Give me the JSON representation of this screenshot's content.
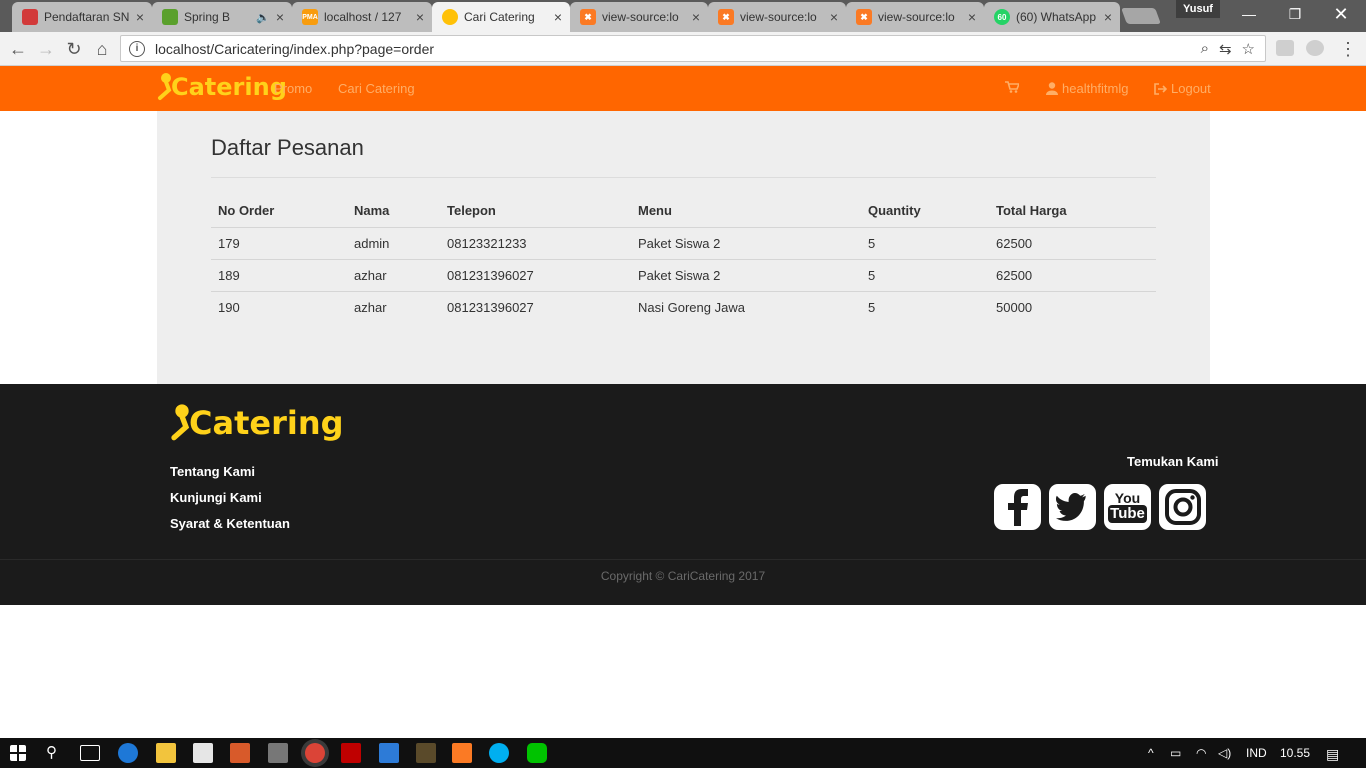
{
  "browser": {
    "tabs": [
      {
        "label": "Pendaftaran SN",
        "icon": "pendaftaran-favicon",
        "color": "#d23a3a"
      },
      {
        "label": "Spring B",
        "icon": "spring-favicon",
        "color": "#5aa02c"
      },
      {
        "label": "localhost / 127",
        "icon": "phpmyadmin-favicon",
        "color": "#f89c0e"
      },
      {
        "label": "Cari Catering",
        "icon": "catering-favicon",
        "color": "#ffc107"
      },
      {
        "label": "view-source:lo",
        "icon": "xampp-favicon",
        "color": "#fb7a24"
      },
      {
        "label": "view-source:lo",
        "icon": "xampp-favicon",
        "color": "#fb7a24"
      },
      {
        "label": "view-source:lo",
        "icon": "xampp-favicon",
        "color": "#fb7a24"
      },
      {
        "label": "(60) WhatsApp",
        "icon": "whatsapp-favicon",
        "color": "#25d366"
      }
    ],
    "profile_name": "Yusuf",
    "url": "localhost/Caricatering/index.php?page=order"
  },
  "site": {
    "brand": "Catering",
    "nav": {
      "promo": "Promo",
      "cari_catering": "Cari Catering"
    },
    "user": {
      "name": "healthfitmlg",
      "logout": "Logout"
    },
    "accent": "#ff6600",
    "logo_color": "#ffd21a"
  },
  "orders": {
    "title": "Daftar Pesanan",
    "columns": [
      "No Order",
      "Nama",
      "Telepon",
      "Menu",
      "Quantity",
      "Total Harga"
    ],
    "rows": [
      [
        "179",
        "admin",
        "08123321233",
        "Paket Siswa 2",
        "5",
        "62500"
      ],
      [
        "189",
        "azhar",
        "081231396027",
        "Paket Siswa 2",
        "5",
        "62500"
      ],
      [
        "190",
        "azhar",
        "081231396027",
        "Nasi Goreng Jawa",
        "5",
        "50000"
      ]
    ]
  },
  "footer": {
    "links": [
      "Tentang Kami",
      "Kunjungi Kami",
      "Syarat & Ketentuan"
    ],
    "find_us": "Temukan Kami",
    "social": [
      "facebook-icon",
      "twitter-icon",
      "youtube-icon",
      "instagram-icon"
    ],
    "youtube_top": "You",
    "youtube_bottom": "Tube",
    "copyright": "Copyright © CariCatering 2017"
  },
  "taskbar": {
    "language": "IND",
    "time": "10.55"
  }
}
